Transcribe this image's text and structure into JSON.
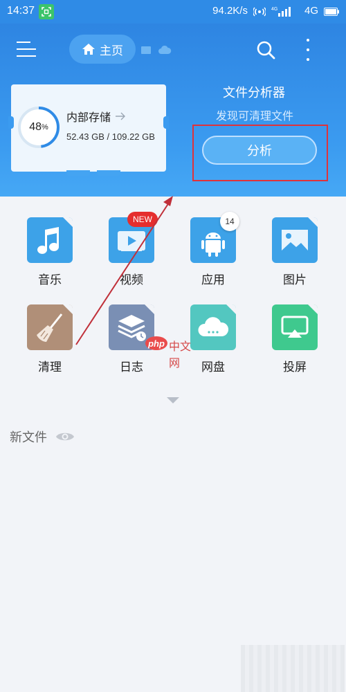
{
  "status_bar": {
    "time": "14:37",
    "speed": "94.2K/s",
    "network": "4G"
  },
  "header": {
    "home_label": "主页"
  },
  "storage": {
    "title": "内部存储",
    "percent": "48",
    "percent_sign": "%",
    "percent_value": 48,
    "usage": "52.43 GB / 109.22 GB"
  },
  "analyzer": {
    "title": "文件分析器",
    "subtitle": "发现可清理文件",
    "button_label": "分析"
  },
  "categories": [
    {
      "label": "音乐",
      "icon": "music-note-icon",
      "color": "#3da2e8"
    },
    {
      "label": "视频",
      "icon": "video-play-icon",
      "color": "#3da2e8",
      "badge": "NEW"
    },
    {
      "label": "应用",
      "icon": "android-icon",
      "color": "#3da2e8",
      "badge": "14"
    },
    {
      "label": "图片",
      "icon": "picture-icon",
      "color": "#3da2e8"
    },
    {
      "label": "清理",
      "icon": "broom-icon",
      "color": "#b08f78"
    },
    {
      "label": "日志",
      "icon": "log-stack-icon",
      "color": "#7a8fb4"
    },
    {
      "label": "网盘",
      "icon": "cloud-icon",
      "color": "#53c7c0"
    },
    {
      "label": "投屏",
      "icon": "screen-cast-icon",
      "color": "#3fc98e"
    }
  ],
  "recent": {
    "title": "新文件"
  },
  "watermark": {
    "logo_text": "php",
    "text": "中文网"
  },
  "colors": {
    "primary": "#2f8be6",
    "highlight_box": "#e0323a",
    "badge_red": "#e52e2e"
  }
}
